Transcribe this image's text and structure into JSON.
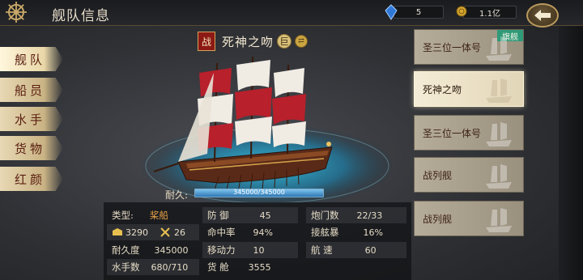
{
  "header": {
    "title": "舰队信息",
    "gems": "5",
    "gold": "1.1亿"
  },
  "nav": {
    "tabs": [
      {
        "label": "舰队",
        "active": true
      },
      {
        "label": "船员",
        "active": false
      },
      {
        "label": "水手",
        "active": false
      },
      {
        "label": "货物",
        "active": false
      },
      {
        "label": "红颜",
        "active": false
      }
    ]
  },
  "ship": {
    "badge": "战",
    "name": "死神之吻",
    "size_badge": "巨",
    "durability_label": "耐久:",
    "durability_text": "345000/345000",
    "durability_fraction": 1.0
  },
  "stats": {
    "type_label": "类型:",
    "type_value": "桨船",
    "cargo_icon_value": "3290",
    "swords_icon_value": "26",
    "durability_label": "耐久度",
    "durability_value": "345000",
    "sailors_label": "水手数",
    "sailors_value": "680/710",
    "defense_label": "防 御",
    "defense_value": "45",
    "hit_label": "命中率",
    "hit_value": "94%",
    "mobility_label": "移动力",
    "mobility_value": "10",
    "hold_label": "货 舱",
    "hold_value": "3555",
    "cannon_label": "炮门数",
    "cannon_value": "22/33",
    "boarding_label": "接舷暴",
    "boarding_value": "16%",
    "speed_label": "航 速",
    "speed_value": "60"
  },
  "fleet": {
    "flagship_badge": "旗舰",
    "ships": [
      {
        "label": "圣三位一体号",
        "selected": false,
        "flagship": true
      },
      {
        "label": "死神之吻",
        "selected": true,
        "flagship": false
      },
      {
        "label": "圣三位一体号",
        "selected": false,
        "flagship": false
      },
      {
        "label": "战列舰",
        "selected": false,
        "flagship": false
      },
      {
        "label": "战列舰",
        "selected": false,
        "flagship": false
      }
    ]
  },
  "colors": {
    "accent_red": "#8c1a14",
    "sail_red": "#b8202c",
    "flagship_green": "#2f9a78",
    "durability_blue": "#3a8ccc"
  }
}
